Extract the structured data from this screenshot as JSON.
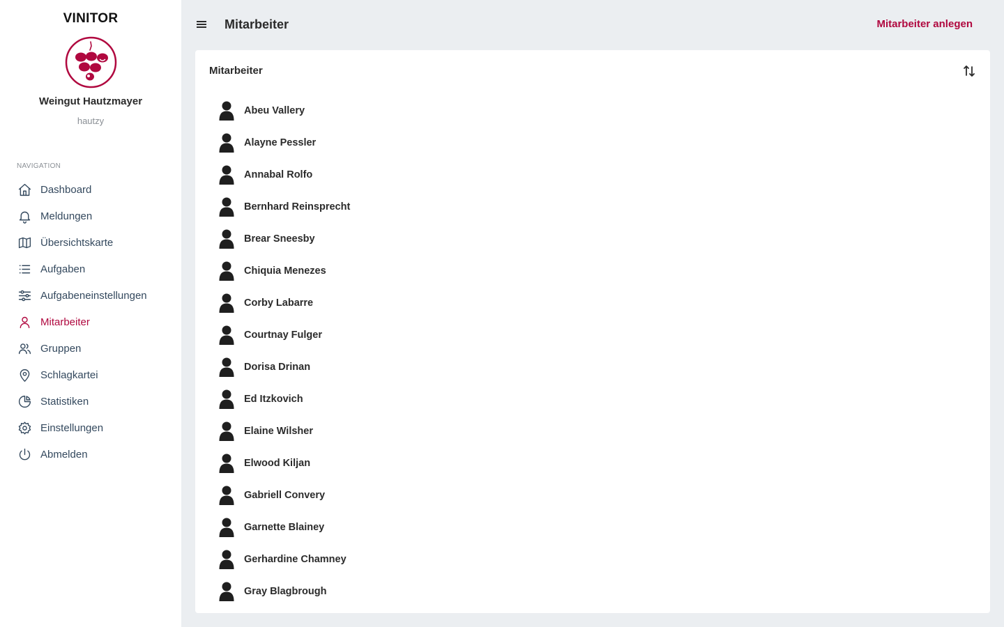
{
  "sidebar": {
    "brand": "VINITOR",
    "company": "Weingut Hautzmayer",
    "username": "hautzy",
    "nav_caption": "NAVIGATION",
    "items": [
      {
        "label": "Dashboard",
        "icon": "home-icon"
      },
      {
        "label": "Meldungen",
        "icon": "bell-icon"
      },
      {
        "label": "Übersichtskarte",
        "icon": "map-icon"
      },
      {
        "label": "Aufgaben",
        "icon": "list-icon"
      },
      {
        "label": "Aufgabeneinstellungen",
        "icon": "sliders-icon"
      },
      {
        "label": "Mitarbeiter",
        "icon": "user-icon",
        "active": true
      },
      {
        "label": "Gruppen",
        "icon": "users-icon"
      },
      {
        "label": "Schlagkartei",
        "icon": "map-pin-icon"
      },
      {
        "label": "Statistiken",
        "icon": "pie-chart-icon"
      },
      {
        "label": "Einstellungen",
        "icon": "gear-icon"
      },
      {
        "label": "Abmelden",
        "icon": "power-icon"
      }
    ]
  },
  "header": {
    "title": "Mitarbeiter",
    "create_label": "Mitarbeiter anlegen"
  },
  "card": {
    "title": "Mitarbeiter",
    "employees": [
      "Abeu Vallery",
      "Alayne Pessler",
      "Annabal Rolfo",
      "Bernhard Reinsprecht",
      "Brear Sneesby",
      "Chiquia Menezes",
      "Corby Labarre",
      "Courtnay Fulger",
      "Dorisa Drinan",
      "Ed Itzkovich",
      "Elaine Wilsher",
      "Elwood Kiljan",
      "Gabriell Convery",
      "Garnette Blainey",
      "Gerhardine Chamney",
      "Gray Blagbrough"
    ]
  },
  "colors": {
    "accent": "#b0083f",
    "background": "#ebeef1",
    "text": "#2b2b2b",
    "nav_text": "#34495e"
  }
}
